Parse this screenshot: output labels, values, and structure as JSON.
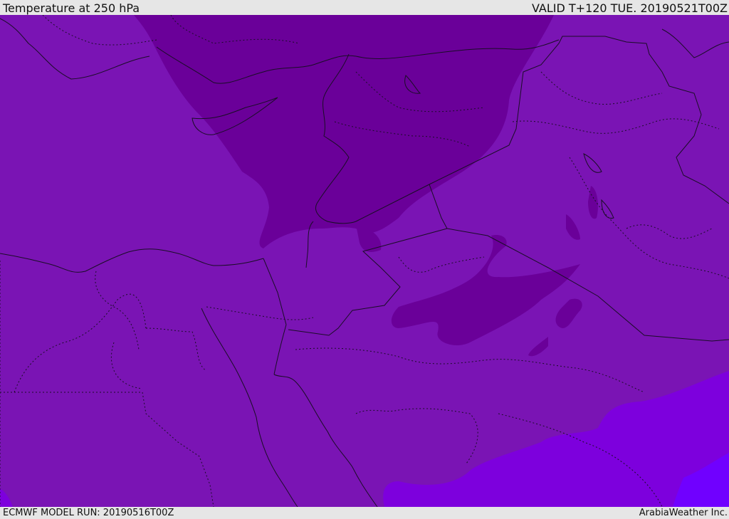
{
  "header": {
    "title": "Temperature at 250 hPa",
    "valid": "VALID T+120 TUE. 20190521T00Z"
  },
  "footer": {
    "model_run": "ECMWF MODEL RUN: 20190516T00Z",
    "provider": "ArabiaWeather Inc."
  },
  "colors": {
    "base_fill": "#7a14b4",
    "cold_fill": "#6a0099",
    "warm_fill": "#7d00dd",
    "warmer_fill": "#7000ff",
    "border_line": "#1a0d26"
  }
}
